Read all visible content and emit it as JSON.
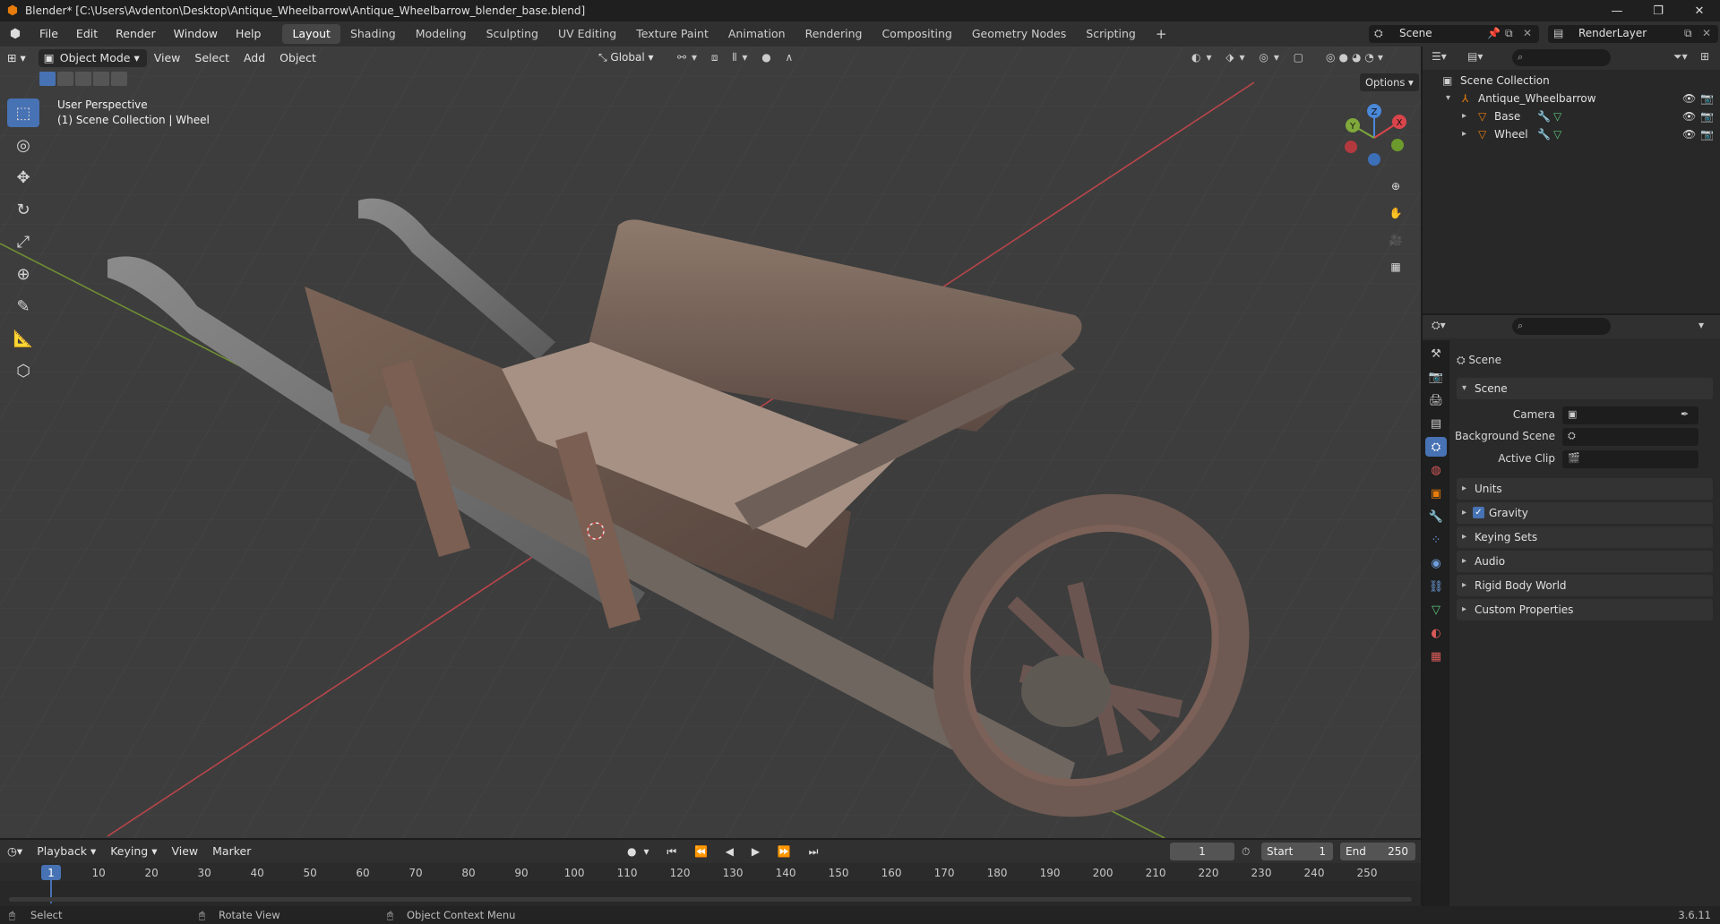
{
  "window": {
    "title": "Blender* [C:\\Users\\Avdenton\\Desktop\\Antique_Wheelbarrow\\Antique_Wheelbarrow_blender_base.blend]",
    "minimize": "—",
    "maximize": "❐",
    "close": "✕"
  },
  "menu": [
    "File",
    "Edit",
    "Render",
    "Window",
    "Help"
  ],
  "workspaces": [
    "Layout",
    "Shading",
    "Modeling",
    "Sculpting",
    "UV Editing",
    "Texture Paint",
    "Animation",
    "Rendering",
    "Compositing",
    "Geometry Nodes",
    "Scripting"
  ],
  "active_workspace": "Layout",
  "scene_selector": "Scene",
  "view_layer_selector": "RenderLayer",
  "viewport": {
    "mode": "Object Mode",
    "menus": [
      "View",
      "Select",
      "Add",
      "Object"
    ],
    "transform_orientation": "Global",
    "options_label": "Options",
    "overlay_line1": "User Perspective",
    "overlay_line2": "(1) Scene Collection | Wheel",
    "gizmo": {
      "x": "X",
      "y": "Y",
      "z": "Z"
    }
  },
  "outliner": {
    "root": "Scene Collection",
    "items": [
      {
        "label": "Antique_Wheelbarrow",
        "level": 1
      },
      {
        "label": "Base",
        "level": 2
      },
      {
        "label": "Wheel",
        "level": 2
      }
    ]
  },
  "properties": {
    "context_title": "Scene",
    "section_scene": "Scene",
    "fields": [
      {
        "label": "Camera"
      },
      {
        "label": "Background Scene"
      },
      {
        "label": "Active Clip"
      }
    ],
    "collapsed_panels": [
      "Units",
      "Gravity",
      "Keying Sets",
      "Audio",
      "Rigid Body World",
      "Custom Properties"
    ],
    "gravity_checked": true
  },
  "timeline": {
    "menus": [
      "Playback",
      "Keying",
      "View",
      "Marker"
    ],
    "current_frame": "1",
    "start_label": "Start",
    "start_value": "1",
    "end_label": "End",
    "end_value": "250",
    "ruler": [
      "1",
      "10",
      "20",
      "30",
      "40",
      "50",
      "60",
      "70",
      "80",
      "90",
      "100",
      "110",
      "120",
      "130",
      "140",
      "150",
      "160",
      "170",
      "180",
      "190",
      "200",
      "210",
      "220",
      "230",
      "240",
      "250"
    ]
  },
  "statusbar": {
    "select": "Select",
    "rotate": "Rotate View",
    "context": "Object Context Menu",
    "version": "3.6.11"
  },
  "colors": {
    "accent": "#4772b3",
    "orange": "#e87d0d",
    "x_axis": "#d9454b",
    "y_axis": "#7fa93b",
    "z_axis": "#4a88d9"
  }
}
